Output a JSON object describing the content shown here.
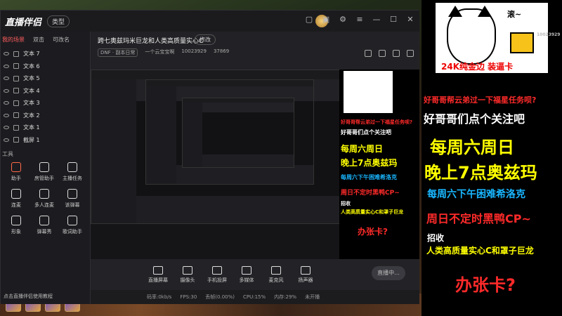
{
  "app": {
    "logo": "直播伴侣",
    "tag": "类型",
    "sidebar_tabs": [
      "我的场景",
      "双击",
      "可改名"
    ],
    "sources": [
      "文本 7",
      "文本 6",
      "文本 5",
      "文本 4",
      "文本 3",
      "文本 2",
      "文本 1",
      "截屏 1"
    ],
    "tools_section": "工具",
    "tools": [
      "助手",
      "房管助手",
      "主播任务",
      "连麦",
      "多人连麦",
      "该弹幕",
      "形象",
      "弹幕秀",
      "歌词助手"
    ],
    "notice": "点击直播伴侣使用教程"
  },
  "stream": {
    "title": "跨七奥兹玛米巨龙和人类高质量实心C",
    "edit_label": "修改",
    "category": "DNF · 副本日常",
    "host_name": "一个云宝宝啊",
    "room_id": "10023929",
    "viewers": "37869"
  },
  "toolbar": {
    "buttons": [
      "直播屏幕",
      "摄像头",
      "手机投屏",
      "多媒体",
      "麦克风",
      "扬声器"
    ],
    "start_label": "直播中..."
  },
  "status": {
    "items": [
      "码率:0kb/s",
      "FPS:30",
      "丢帧(0.00%)",
      "CPU:15%",
      "内存:29%",
      "未开播"
    ]
  },
  "overlay": {
    "bubble": "滚~",
    "brand_line": "24K纯金边  装逼卡",
    "watermark": "10023929",
    "lines": [
      {
        "text": "好哥哥帮云弟过一下福星任务呗?",
        "color": "#ff2a2a"
      },
      {
        "text": "好哥哥们点个关注吧",
        "color": "#ffffff"
      },
      {
        "text": "每周六周日",
        "color": "#ffff00"
      },
      {
        "text": "晚上7点奥兹玛",
        "color": "#ffff00"
      },
      {
        "text": "每周六下午困难希洛克",
        "color": "#19b6ff"
      },
      {
        "text": "周日不定时黑鸭CP~",
        "color": "#ff2a2a"
      },
      {
        "text": "招收",
        "color": "#ffffff"
      },
      {
        "text": "人类高质量实心C和罩子巨龙",
        "color": "#ffff00"
      },
      {
        "text": "办张卡?",
        "color": "#ff2a2a"
      }
    ]
  }
}
